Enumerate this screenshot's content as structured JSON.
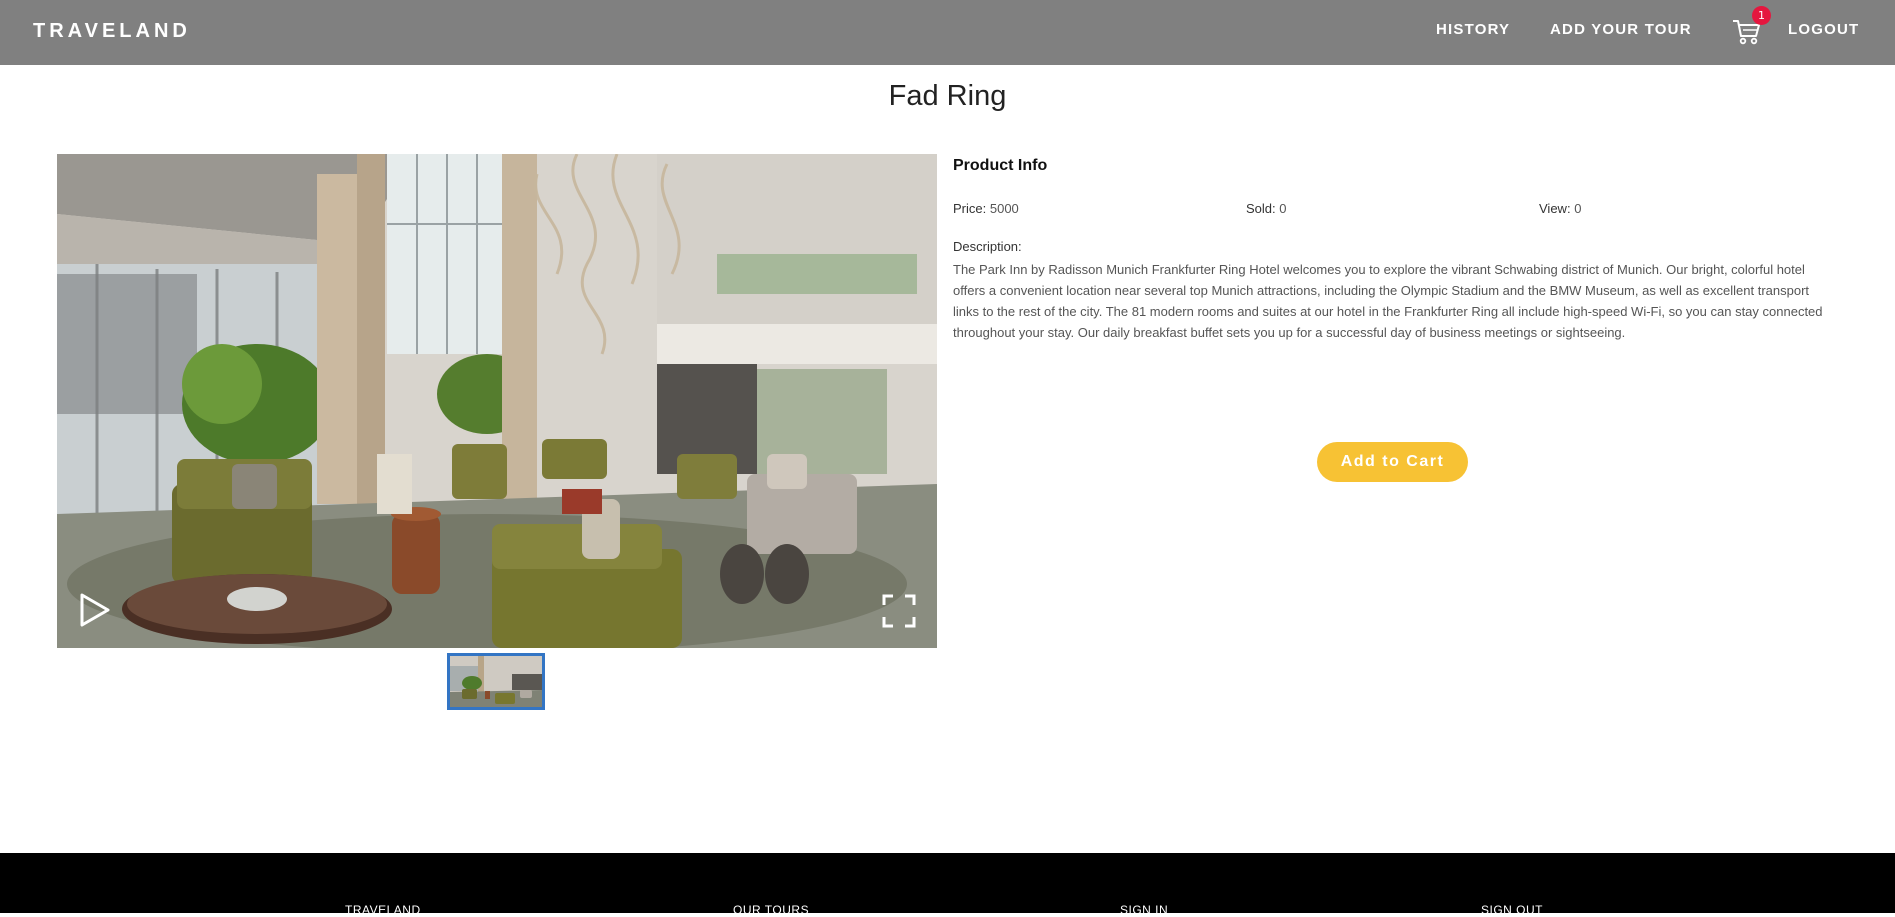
{
  "navbar": {
    "brand": "TRAVELAND",
    "links": [
      "HISTORY",
      "ADD YOUR TOUR",
      "LOGOUT"
    ],
    "cart_count": "1"
  },
  "product": {
    "title": "Fad Ring",
    "info_title": "Product Info",
    "price_label": "Price:",
    "price_value": "5000",
    "sold_label": "Sold:",
    "sold_value": "0",
    "view_label": "View:",
    "view_value": "0",
    "description_label": "Description:",
    "description": "The Park Inn by Radisson Munich Frankfurter Ring Hotel welcomes you to explore the vibrant Schwabing district of Munich. Our bright, colorful hotel offers a convenient location near several top Munich attractions, including the Olympic Stadium and the BMW Museum, as well as excellent transport links to the rest of the city. The 81 modern rooms and suites at our hotel in the Frankfurter Ring all include high-speed Wi-Fi, so you can stay connected throughout your stay. Our daily breakfast buffet sets you up for a successful day of business meetings or sightseeing.",
    "add_to_cart": "Add to Cart"
  },
  "footer": {
    "columns": [
      "TRAVELAND",
      "OUR TOURS",
      "SIGN IN",
      "SIGN OUT"
    ]
  },
  "colors": {
    "navbar": "#808080",
    "accent": "#f7c234",
    "badge": "#e5173f",
    "thumb_border": "#3375c4",
    "footer": "#000000"
  },
  "icons": [
    "cart-icon",
    "play-icon",
    "fullscreen-icon"
  ]
}
